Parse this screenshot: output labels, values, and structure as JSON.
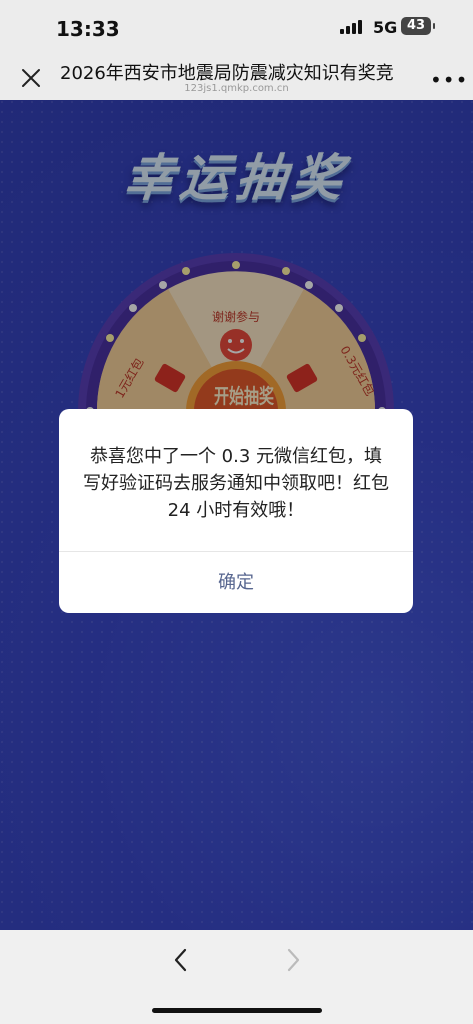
{
  "status_bar": {
    "time": "13:33",
    "network": "5G",
    "battery": "43"
  },
  "nav": {
    "title": "2026年西安市地震局防震减灾知识有奖竞",
    "subtitle": "123js1.qmkp.com.cn",
    "more": "•••"
  },
  "page": {
    "lottery_title": "幸运抽奖",
    "wheel": {
      "segments": [
        "谢谢参与",
        "0.3元红包",
        "1元红包"
      ],
      "center": "开始抽奖"
    }
  },
  "dialog": {
    "message": "恭喜您中了一个 0.3 元微信红包，填写好验证码去服务通知中领取吧！红包 24 小时有效哦！",
    "confirm_label": "确定"
  },
  "colors": {
    "background": "#3a48c8",
    "wheel_rim": "#5a3fb8",
    "wheel_slice": "#fbe7c6",
    "wheel_slice_alt": "#f6d29c",
    "center_button": "#e25a2c"
  }
}
